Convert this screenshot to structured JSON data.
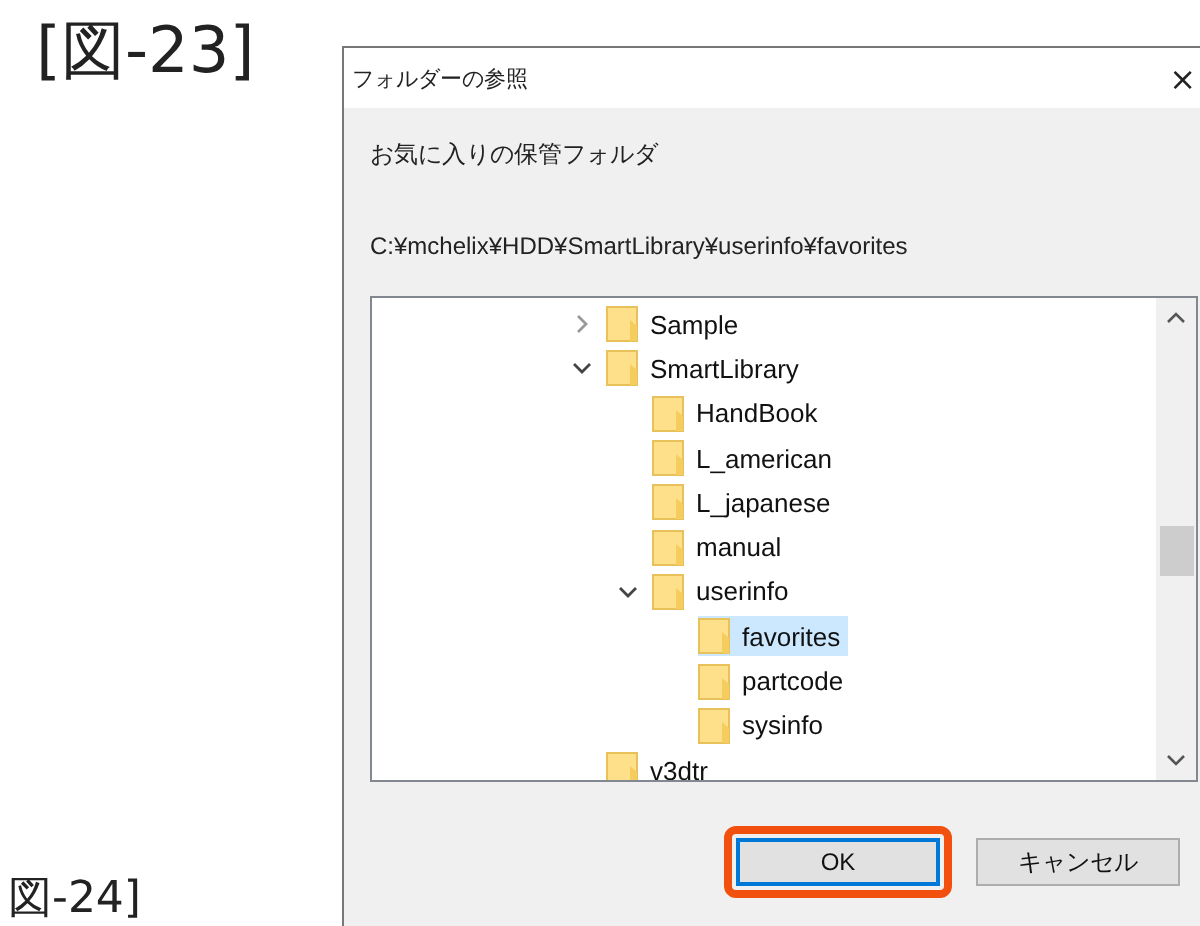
{
  "figure_labels": [
    "[図-23]",
    "図-24]"
  ],
  "window": {
    "title": "フォルダーの参照",
    "close": "×"
  },
  "description": "お気に入りの保管フォルダ",
  "path": "C:¥mchelix¥HDD¥SmartLibrary¥userinfo¥favorites",
  "tree": [
    {
      "label": "Sample",
      "expanded": false,
      "selected": false
    },
    {
      "label": "SmartLibrary",
      "expanded": true,
      "selected": false,
      "children": [
        {
          "label": "HandBook",
          "selected": false
        },
        {
          "label": "L_american",
          "selected": false
        },
        {
          "label": "L_japanese",
          "selected": false
        },
        {
          "label": "manual",
          "selected": false
        },
        {
          "label": "userinfo",
          "expanded": true,
          "selected": false,
          "children": [
            {
              "label": "favorites",
              "selected": true
            },
            {
              "label": "partcode",
              "selected": false
            },
            {
              "label": "sysinfo",
              "selected": false
            }
          ]
        }
      ]
    },
    {
      "label": "v3dtr",
      "selected": false
    }
  ],
  "buttons": [
    {
      "label": "OK",
      "focused": true,
      "highlighted": true
    },
    {
      "label": "キャンセル",
      "focused": false,
      "highlighted": false
    }
  ]
}
